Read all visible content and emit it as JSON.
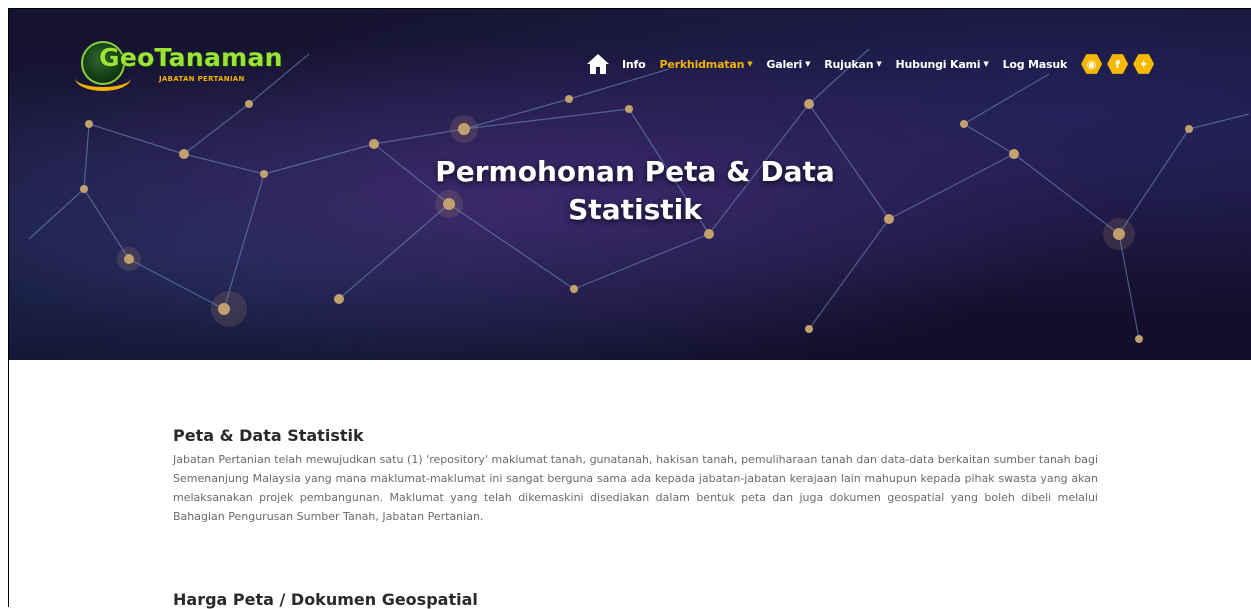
{
  "logo": {
    "brand": "GeoTanaman",
    "subtitle": "JABATAN PERTANIAN"
  },
  "nav": {
    "home_icon": "home-icon",
    "items": [
      {
        "label": "Info",
        "dropdown": false
      },
      {
        "label": "Perkhidmatan",
        "dropdown": true,
        "active": true
      },
      {
        "label": "Galeri",
        "dropdown": true
      },
      {
        "label": "Rujukan",
        "dropdown": true
      },
      {
        "label": "Hubungi Kami",
        "dropdown": true
      },
      {
        "label": "Log Masuk",
        "dropdown": false
      }
    ],
    "socials": [
      {
        "icon": "instagram-icon",
        "glyph": "◉"
      },
      {
        "icon": "facebook-icon",
        "glyph": "f"
      },
      {
        "icon": "twitter-icon",
        "glyph": "✦"
      }
    ],
    "active_color": "#f0b300"
  },
  "hero": {
    "title_line1": "Permohonan Peta & Data",
    "title_line2": "Statistik"
  },
  "section1": {
    "heading": "Peta & Data Statistik",
    "paragraph": "Jabatan Pertanian telah mewujudkan satu (1) 'repository' maklumat tanah, gunatanah, hakisan tanah, pemuliharaan tanah dan data-data berkaitan sumber tanah bagi Semenanjung Malaysia yang mana maklumat-maklumat ini sangat berguna sama ada kepada jabatan-jabatan kerajaan lain mahupun kepada pihak swasta yang akan melaksanakan projek pembangunan. Maklumat yang telah dikemaskini disediakan dalam bentuk peta dan juga dokumen geospatial yang boleh dibeli melalui Bahagian Pengurusan Sumber Tanah, Jabatan Pertanian."
  },
  "section2": {
    "heading": "Harga Peta / Dokumen Geospatial"
  }
}
